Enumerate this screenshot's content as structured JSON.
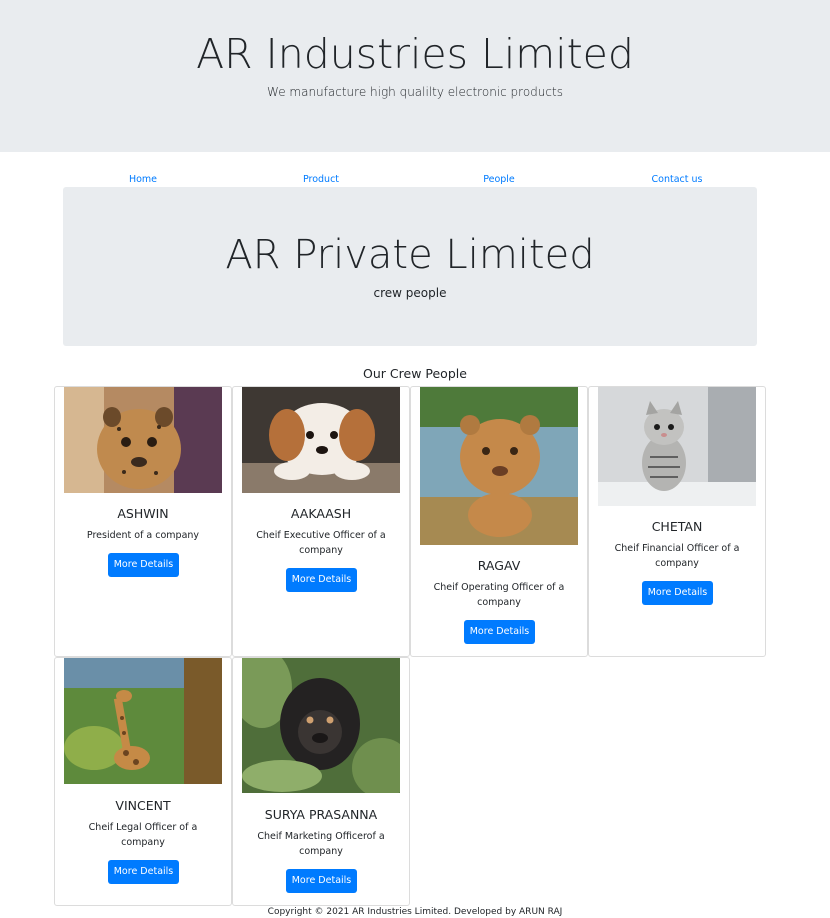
{
  "header": {
    "title": "AR Industries Limited",
    "tagline": "We manufacture high qualilty electronic products"
  },
  "nav": {
    "items": [
      "Home",
      "Product",
      "People",
      "Contact us"
    ]
  },
  "banner": {
    "title": "AR Private Limited",
    "subtitle": "crew people"
  },
  "section": {
    "title": "Our Crew People"
  },
  "cards": [
    {
      "name": "ASHWIN",
      "role": "President of a company",
      "button": "More Details",
      "image": "cheetah-cub-photo"
    },
    {
      "name": "AAKAASH",
      "role": "Cheif Executive Officer of a company",
      "button": "More Details",
      "image": "puppy-photo"
    },
    {
      "name": "RAGAV",
      "role": "Cheif Operating Officer of a company",
      "button": "More Details",
      "image": "lion-cub-photo"
    },
    {
      "name": "CHETAN",
      "role": "Cheif Financial Officer of a company",
      "button": "More Details",
      "image": "kitten-photo"
    },
    {
      "name": "VINCENT",
      "role": "Cheif Legal Officer of a company",
      "button": "More Details",
      "image": "giraffe-photo"
    },
    {
      "name": "SURYA PRASANNA",
      "role": "Cheif Marketing Officerof a company",
      "button": "More Details",
      "image": "gorilla-baby-photo"
    }
  ],
  "footer": {
    "text": "Copyright © 2021 AR Industries Limited. Developed by ARUN RAJ"
  },
  "colors": {
    "jumbotron": "#e9ecef",
    "primary": "#007bff"
  }
}
